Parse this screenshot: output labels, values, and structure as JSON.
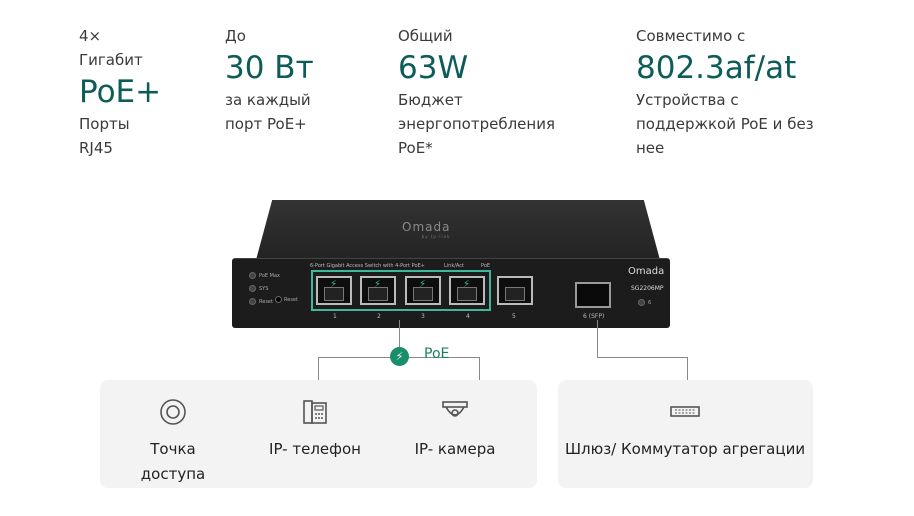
{
  "specs": [
    {
      "line1": "4×",
      "line2": "Гигабит",
      "big": "PoE+",
      "line3": "Порты",
      "line4": "RJ45"
    },
    {
      "line1": "До",
      "big": "30 Вт",
      "line2": "за каждый",
      "line3": "порт PoE+"
    },
    {
      "line1": "Общий",
      "big": "63W",
      "line2": "Бюджет",
      "line3": "энергопотребления",
      "line4": "PoE*"
    },
    {
      "line1": "Совместимо с",
      "big": "802.3af/at",
      "line2": "Устройства с",
      "line3": "поддержкой PoE и без",
      "line4": "нее"
    }
  ],
  "switch": {
    "brand_top": "Omada",
    "brand_top_sub": "by tp-link",
    "brand_front": "Omada",
    "model": "SG2206MP",
    "leds": [
      "PoE Max",
      "SYS",
      "Reset"
    ],
    "led_extra": "Reset",
    "port_numbers": [
      "1",
      "2",
      "3",
      "4",
      "5"
    ],
    "sfp_label": "6 (SFP)",
    "header_text": "6-Port Gigabit Access Switch with 4-Port PoE+",
    "link_act": "Link/Act",
    "poe_text": "PoE",
    "sfp_port_num": "6"
  },
  "poe_label": "PoE",
  "devices_left": [
    {
      "label1": "Точка",
      "label2": "доступа"
    },
    {
      "label1": "IP- телефон"
    },
    {
      "label1": "IP- камера"
    }
  ],
  "devices_right": [
    {
      "label1": "Шлюз/ Коммутатор агрегации"
    }
  ]
}
